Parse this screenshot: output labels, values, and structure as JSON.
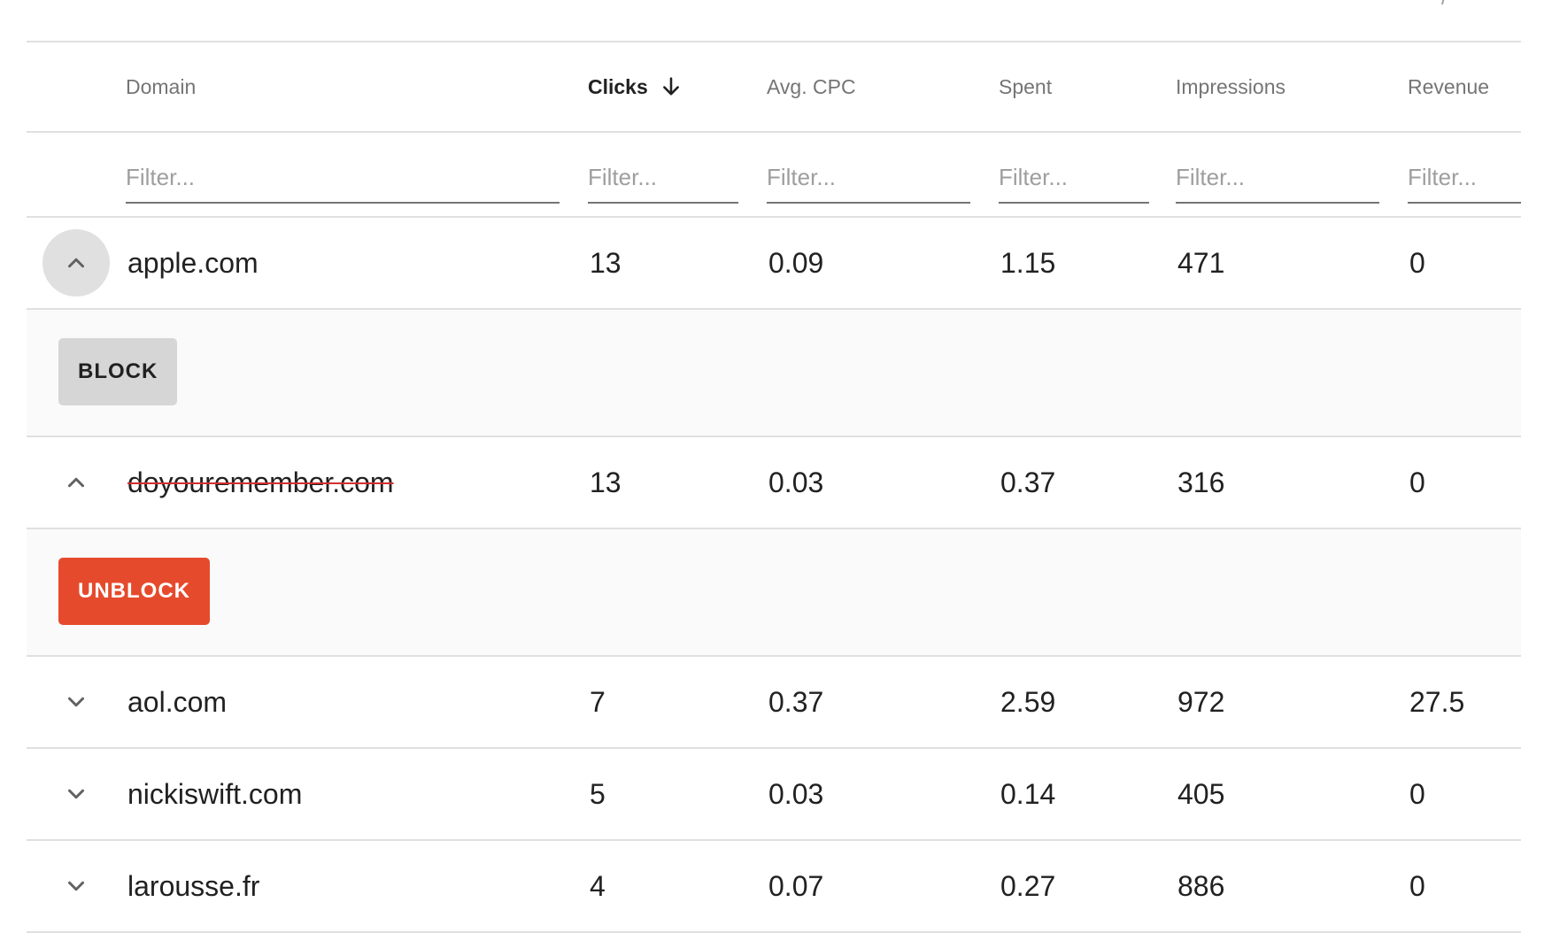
{
  "top_fragment": "/",
  "columns": {
    "domain": "Domain",
    "clicks": "Clicks",
    "avg_cpc": "Avg. CPC",
    "spent": "Spent",
    "impressions": "Impressions",
    "revenue": "Revenue"
  },
  "sort": {
    "column": "clicks",
    "direction": "descending",
    "icon": "arrow-down-icon"
  },
  "filter_placeholder": "Filter...",
  "filters": {
    "domain": "",
    "clicks": "",
    "avg_cpc": "",
    "spent": "",
    "impressions": "",
    "revenue": ""
  },
  "rows": [
    {
      "domain": "apple.com",
      "clicks": "13",
      "avg_cpc": "0.09",
      "spent": "1.15",
      "impressions": "471",
      "revenue": "0",
      "expanded": true,
      "blocked": false,
      "action_label": "BLOCK",
      "toggle_icon": "chevron-up-icon"
    },
    {
      "domain": "doyouremember.com",
      "clicks": "13",
      "avg_cpc": "0.03",
      "spent": "0.37",
      "impressions": "316",
      "revenue": "0",
      "expanded": true,
      "blocked": true,
      "action_label": "UNBLOCK",
      "toggle_icon": "chevron-up-icon"
    },
    {
      "domain": "aol.com",
      "clicks": "7",
      "avg_cpc": "0.37",
      "spent": "2.59",
      "impressions": "972",
      "revenue": "27.5",
      "expanded": false,
      "blocked": false,
      "toggle_icon": "chevron-down-icon"
    },
    {
      "domain": "nickiswift.com",
      "clicks": "5",
      "avg_cpc": "0.03",
      "spent": "0.14",
      "impressions": "405",
      "revenue": "0",
      "expanded": false,
      "blocked": false,
      "toggle_icon": "chevron-down-icon"
    },
    {
      "domain": "larousse.fr",
      "clicks": "4",
      "avg_cpc": "0.07",
      "spent": "0.27",
      "impressions": "886",
      "revenue": "0",
      "expanded": false,
      "blocked": false,
      "toggle_icon": "chevron-down-icon"
    }
  ],
  "colors": {
    "block_button": "#d6d6d6",
    "unblock_button": "#e64a2c",
    "strikethrough": "#d32f2f",
    "expanded_toggle_bg": "#e0e0e0"
  }
}
